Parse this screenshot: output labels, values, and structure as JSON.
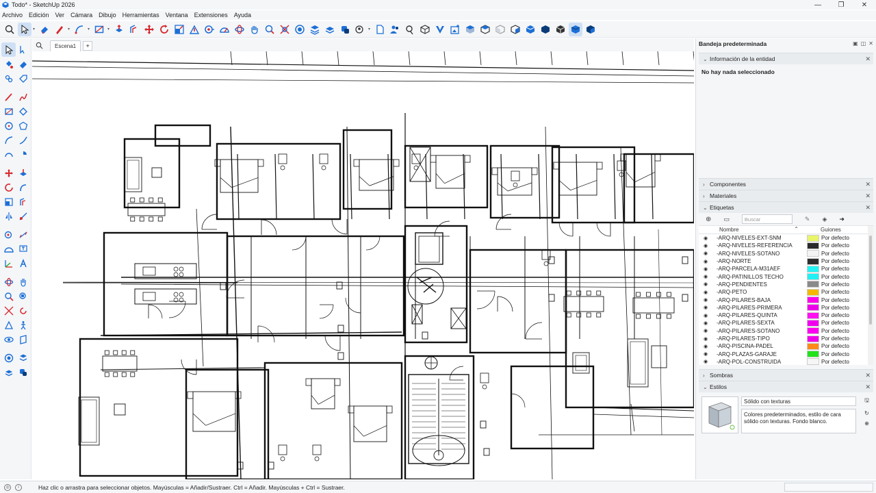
{
  "window": {
    "title": "Todo* - SketchUp 2026",
    "controls": [
      "—",
      "❐",
      "✕"
    ]
  },
  "menu": [
    "Archivo",
    "Edición",
    "Ver",
    "Cámara",
    "Dibujo",
    "Herramientas",
    "Ventana",
    "Extensiones",
    "Ayuda"
  ],
  "toolbar": {
    "icons": [
      "search-icon",
      "select-icon",
      "eraser-icon",
      "pencil-icon",
      "arc-icon",
      "rectangle-icon",
      "pushpull-icon",
      "offset-icon",
      "move-icon",
      "rotate-icon",
      "scale-icon",
      "followme-icon",
      "tape-icon",
      "protractor-icon",
      "orbit-icon",
      "pan-icon",
      "zoom-icon",
      "zoom-extents-icon",
      "layers-icon",
      "shadow-icon",
      "styles-icon",
      "warehouse-icon",
      "file-icon",
      "users-icon",
      "section-icon",
      "cube-icon",
      "trimble-icon",
      "image-icon",
      "iso-view-icon",
      "top-view-icon",
      "front-view-icon",
      "right-view-icon",
      "back-view-icon",
      "left-view-icon",
      "xray-icon",
      "shaded-icon"
    ]
  },
  "scene": {
    "tab": "Escena1",
    "add": "+"
  },
  "tray": {
    "title": "Bandeja predeterminada",
    "entity_info": {
      "header": "Información de la entidad",
      "message": "No hay nada seleccionado"
    },
    "components": "Componentes",
    "materials": "Materiales",
    "tags": {
      "header": "Etiquetas",
      "search_placeholder": "Buscar",
      "col_name": "Nombre",
      "col_dash": "Guiones",
      "rows": [
        {
          "name": "-ARQ-NIVELES-EXT-SNM",
          "color": "#e9f56a",
          "dash": "Por defecto"
        },
        {
          "name": "-ARQ-NIVELES-REFERENCIA",
          "color": "#2a2a2a",
          "dash": "Por defecto"
        },
        {
          "name": "-ARQ-NIVELES-SOTANO",
          "color": "#f3f3f3",
          "dash": "Por defecto"
        },
        {
          "name": "-ARQ-NORTE",
          "color": "#2e2e2e",
          "dash": "Por defecto"
        },
        {
          "name": "-ARQ-PARCELA-M31AEF",
          "color": "#26f4f4",
          "dash": "Por defecto"
        },
        {
          "name": "-ARQ-PATINILLOS TECHO",
          "color": "#22f1f3",
          "dash": "Por defecto"
        },
        {
          "name": "-ARQ-PENDIENTES",
          "color": "#8a8a8a",
          "dash": "Por defecto"
        },
        {
          "name": "-ARQ-PETO",
          "color": "#f5b800",
          "dash": "Por defecto"
        },
        {
          "name": "-ARQ-PILARES-BAJA",
          "color": "#ff00ea",
          "dash": "Por defecto"
        },
        {
          "name": "-ARQ-PILARES-PRIMERA",
          "color": "#ee00ea",
          "dash": "Por defecto"
        },
        {
          "name": "-ARQ-PILARES-QUINTA",
          "color": "#ff10f0",
          "dash": "Por defecto"
        },
        {
          "name": "-ARQ-PILARES-SEXTA",
          "color": "#f000ee",
          "dash": "Por defecto"
        },
        {
          "name": "-ARQ-PILARES-SOTANO",
          "color": "#ff00f0",
          "dash": "Por defecto"
        },
        {
          "name": "-ARQ-PILARES-TIPO",
          "color": "#f000e8",
          "dash": "Por defecto"
        },
        {
          "name": "-ARQ-PISCINA-PADEL",
          "color": "#ff8a1a",
          "dash": "Por defecto"
        },
        {
          "name": "-ARQ-PLAZAS-GARAJE",
          "color": "#22e21c",
          "dash": "Por defecto"
        },
        {
          "name": "-ARQ-POL-CONSTRUIDA",
          "color": "#f6f6f6",
          "dash": "Por defecto"
        }
      ]
    },
    "shadows": "Sombras",
    "styles": {
      "header": "Estilos",
      "name": "Sólido con texturas",
      "description": "Colores predeterminados, estilo de cara sólido con texturas. Fondo blanco."
    }
  },
  "status": {
    "text": "Haz clic o arrastra para seleccionar objetos. Mayúsculas = Añadir/Sustraer. Ctrl = Añadir. Mayúsculas + Ctrl = Sustraer."
  },
  "colors": {
    "chrome": "#f4f6f8",
    "selected": "#cfe0f5",
    "accent": "#1d6fd6",
    "toolbar_red": "#d6282e"
  }
}
